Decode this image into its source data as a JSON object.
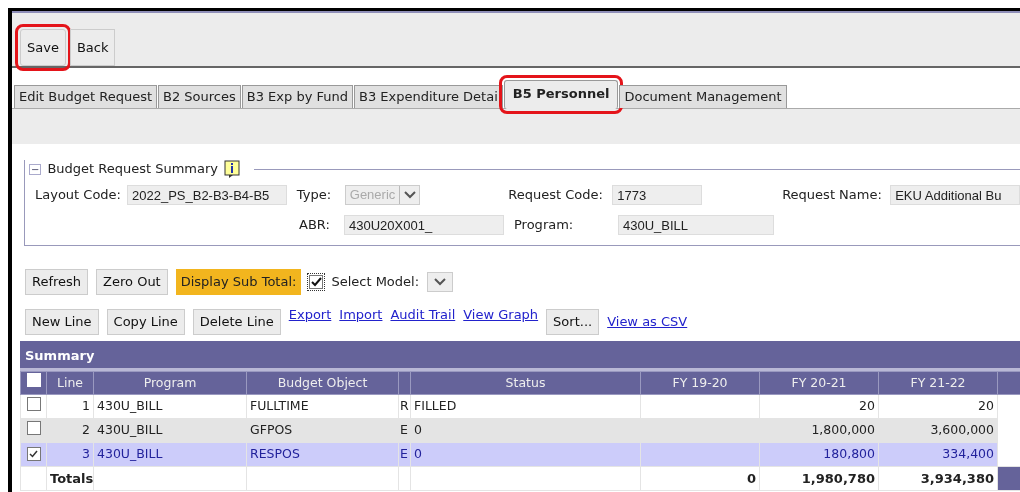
{
  "toolbar": [
    {
      "label": "Save",
      "highlighted": true
    },
    {
      "label": "Back",
      "highlighted": false
    }
  ],
  "tabs": [
    {
      "label": "Edit Budget Request",
      "selected": false,
      "highlighted": false
    },
    {
      "label": "B2 Sources",
      "selected": false,
      "highlighted": false
    },
    {
      "label": "B3 Exp by Fund",
      "selected": false,
      "highlighted": false
    },
    {
      "label": "B3 Expenditure Detai",
      "selected": false,
      "highlighted": false
    },
    {
      "label": "B5 Personnel",
      "selected": true,
      "highlighted": true
    },
    {
      "label": "Document Management",
      "selected": false,
      "highlighted": false
    }
  ],
  "summary": {
    "toggle": "−",
    "title": "Budget Request Summary",
    "fields": [
      {
        "label": "Layout Code:",
        "value": "2022_PS_B2-B3-B4-B5",
        "kind": "text"
      },
      {
        "label": "Type:",
        "value": "Generic",
        "kind": "select",
        "disabled": true
      },
      {
        "label": "Request Code:",
        "value": "1773",
        "kind": "text"
      },
      {
        "label": "Request Name:",
        "value": "EKU Additional Bu",
        "kind": "text"
      },
      {
        "label": "ABR:",
        "value": "430U20X001_",
        "kind": "text"
      },
      {
        "label": "Program:",
        "value": "430U_BILL",
        "kind": "text"
      }
    ]
  },
  "actions1": {
    "buttons": [
      "Refresh",
      "Zero Out"
    ],
    "subtotal_label": "Display Sub Total:",
    "subtotal_checked": true,
    "model_label": "Select Model:"
  },
  "actions2": {
    "buttons": [
      "New Line",
      "Copy Line",
      "Delete Line"
    ],
    "links": [
      "Export",
      "Import",
      "Audit Trail",
      "View Graph"
    ],
    "sort": "Sort...",
    "csv": "View as CSV"
  },
  "table": {
    "title": "Summary",
    "all_checked": false,
    "columns": [
      "Line",
      "Program",
      "Budget Object",
      "",
      "Status",
      "FY 19-20",
      "FY 20-21",
      "FY 21-22"
    ],
    "rows": [
      {
        "checked": false,
        "selected": false,
        "cells": [
          "1",
          "430U_BILL",
          "FULLTIME",
          "R",
          "FILLED",
          "",
          "20",
          "20"
        ]
      },
      {
        "checked": false,
        "selected": false,
        "cells": [
          "2",
          "430U_BILL",
          "GFPOS",
          "E",
          "0",
          "",
          "1,800,000",
          "3,600,000"
        ]
      },
      {
        "checked": true,
        "selected": true,
        "cells": [
          "3",
          "430U_BILL",
          "RESPOS",
          "E",
          "0",
          "",
          "180,800",
          "334,400"
        ]
      }
    ],
    "totals": {
      "label": "Totals",
      "values": [
        "0",
        "1,980,780",
        "3,934,380"
      ]
    }
  }
}
